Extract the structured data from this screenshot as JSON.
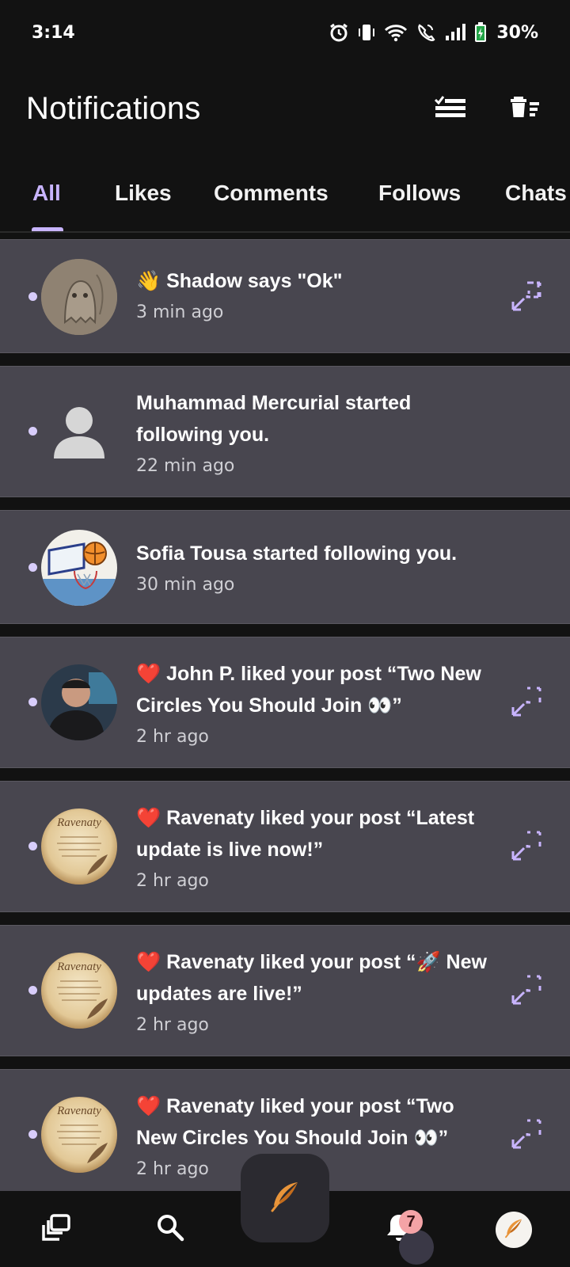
{
  "status_bar": {
    "time": "3:14",
    "battery_percent": "30%",
    "icons": [
      "alarm-icon",
      "vibrate-icon",
      "wifi-icon",
      "wifi-calling-icon",
      "signal-icon",
      "battery-charging-icon"
    ]
  },
  "header": {
    "title": "Notifications",
    "actions": [
      "mark-all-read-icon",
      "clear-all-icon"
    ]
  },
  "tabs": [
    {
      "label": "All",
      "active": true
    },
    {
      "label": "Likes",
      "active": false
    },
    {
      "label": "Comments",
      "active": false
    },
    {
      "label": "Follows",
      "active": false
    },
    {
      "label": "Chats",
      "active": false
    }
  ],
  "notifications": [
    {
      "emoji": "👋",
      "text": "Shadow says \"Ok\"",
      "time": "3 min ago",
      "avatar": "ghost-sketch",
      "unread": true,
      "expandable": true
    },
    {
      "emoji": "",
      "text": "Muhammad Mercurial started following you.",
      "time": "22 min ago",
      "avatar": "default-person",
      "unread": true,
      "expandable": false
    },
    {
      "emoji": "",
      "text": "Sofia Tousa started following you.",
      "time": "30 min ago",
      "avatar": "basketball-hoop",
      "unread": true,
      "expandable": false
    },
    {
      "emoji": "❤️",
      "text": "John P. liked your post “Two New Circles You Should Join 👀”",
      "time": "2 hr ago",
      "avatar": "man-photo",
      "unread": true,
      "expandable": true
    },
    {
      "emoji": "❤️",
      "text": "Ravenaty liked your post “Latest update is live now!”",
      "time": "2 hr ago",
      "avatar": "ravenaty-parchment",
      "unread": true,
      "expandable": true
    },
    {
      "emoji": "❤️",
      "text": "Ravenaty liked your post “🚀 New updates are live!”",
      "time": "2 hr ago",
      "avatar": "ravenaty-parchment",
      "unread": true,
      "expandable": true
    },
    {
      "emoji": "❤️",
      "text": "Ravenaty liked your post “Two New Circles You Should Join 👀”",
      "time": "2 hr ago",
      "avatar": "ravenaty-parchment",
      "unread": true,
      "expandable": true
    }
  ],
  "avatar_text": {
    "ravenaty": "Ravenaty"
  },
  "bottom_nav": {
    "items": [
      "circles-icon",
      "search-icon",
      "compose-feather-icon",
      "notifications-bell-icon",
      "profile-avatar"
    ],
    "notification_badge": "7"
  },
  "colors": {
    "accent": "#c8b4ff",
    "card_bg": "#48464f",
    "background": "#121212",
    "unread_dot": "#d8cdfb",
    "badge": "#f4a3a6"
  }
}
